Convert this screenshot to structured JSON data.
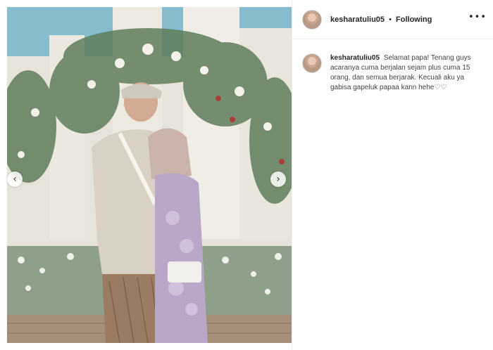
{
  "post": {
    "username": "kesharatuliu05",
    "separator": "•",
    "follow_status": "Following",
    "more_label": "•••",
    "caption_text": "Selamat papa! Tenang guys acaranya cuma berjalan sejam plus cuma 15 orang, dan semua berjarak. Kecuali aku ya gabisa gapeluk papaa kann hehe♡♡"
  },
  "carousel": {
    "prev_label": "‹",
    "next_label": "›"
  }
}
